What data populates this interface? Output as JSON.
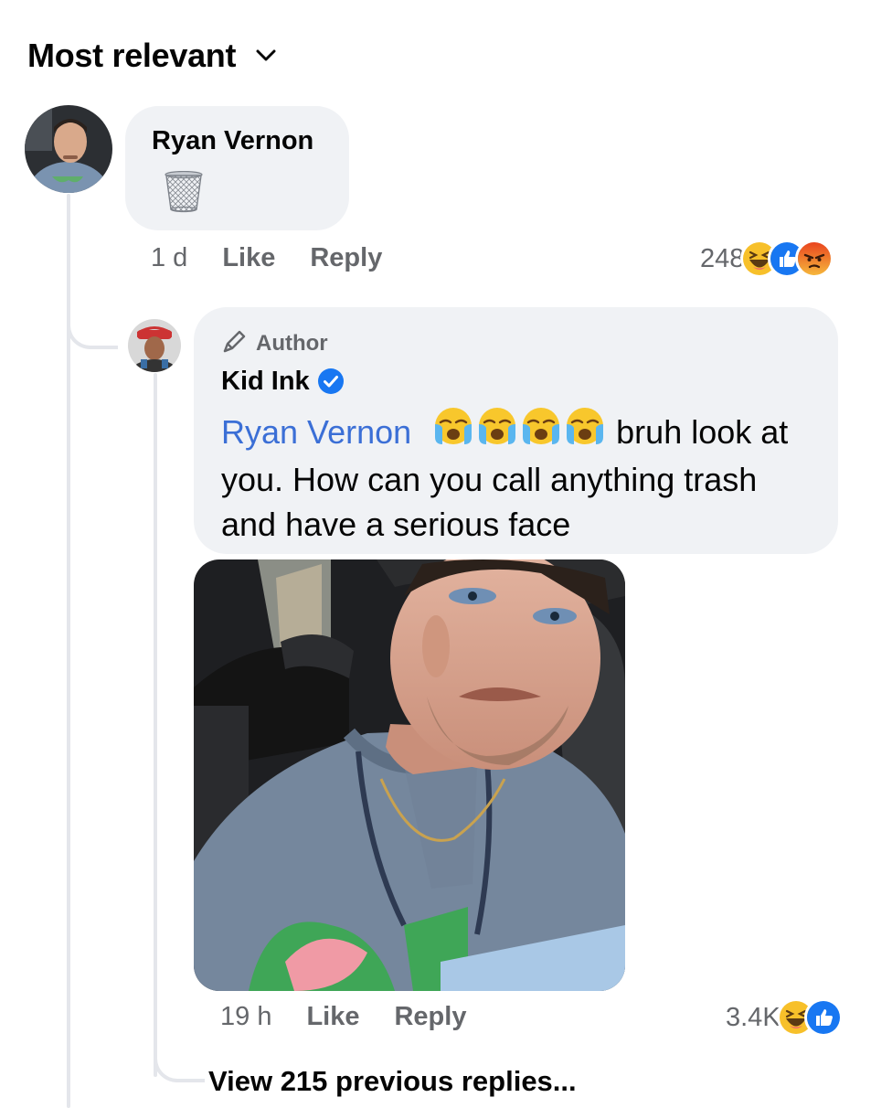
{
  "header": {
    "sort_label": "Most relevant",
    "chevron_icon": "chevron-down-icon"
  },
  "comment": {
    "author": "Ryan Vernon",
    "content_icon": "trash-can-icon",
    "time": "1 d",
    "like_label": "Like",
    "reply_label": "Reply",
    "reaction_count": "248",
    "reactions": [
      "haha-emoji",
      "like-emoji",
      "angry-emoji"
    ]
  },
  "reply": {
    "badge_icon": "pencil-icon",
    "badge_label": "Author",
    "author": "Kid Ink",
    "verified_icon": "verified-badge-icon",
    "mention": "Ryan Vernon",
    "emojis": [
      "loudly-crying-emoji",
      "loudly-crying-emoji",
      "loudly-crying-emoji",
      "loudly-crying-emoji"
    ],
    "text_line1_after": "bruh look at",
    "text_line2": "you. How can you call anything trash",
    "text_line3": "and have a serious face",
    "time": "19 h",
    "like_label": "Like",
    "reply_label": "Reply",
    "reaction_count": "3.4K",
    "reactions": [
      "haha-emoji",
      "like-emoji"
    ]
  },
  "view_more_label": "View 215 previous replies...",
  "colors": {
    "mention": "#3b6fd6",
    "bubble": "#f0f2f5",
    "meta": "#65676b",
    "like_blue": "#1877f2",
    "thread_line": "#e4e6eb"
  }
}
